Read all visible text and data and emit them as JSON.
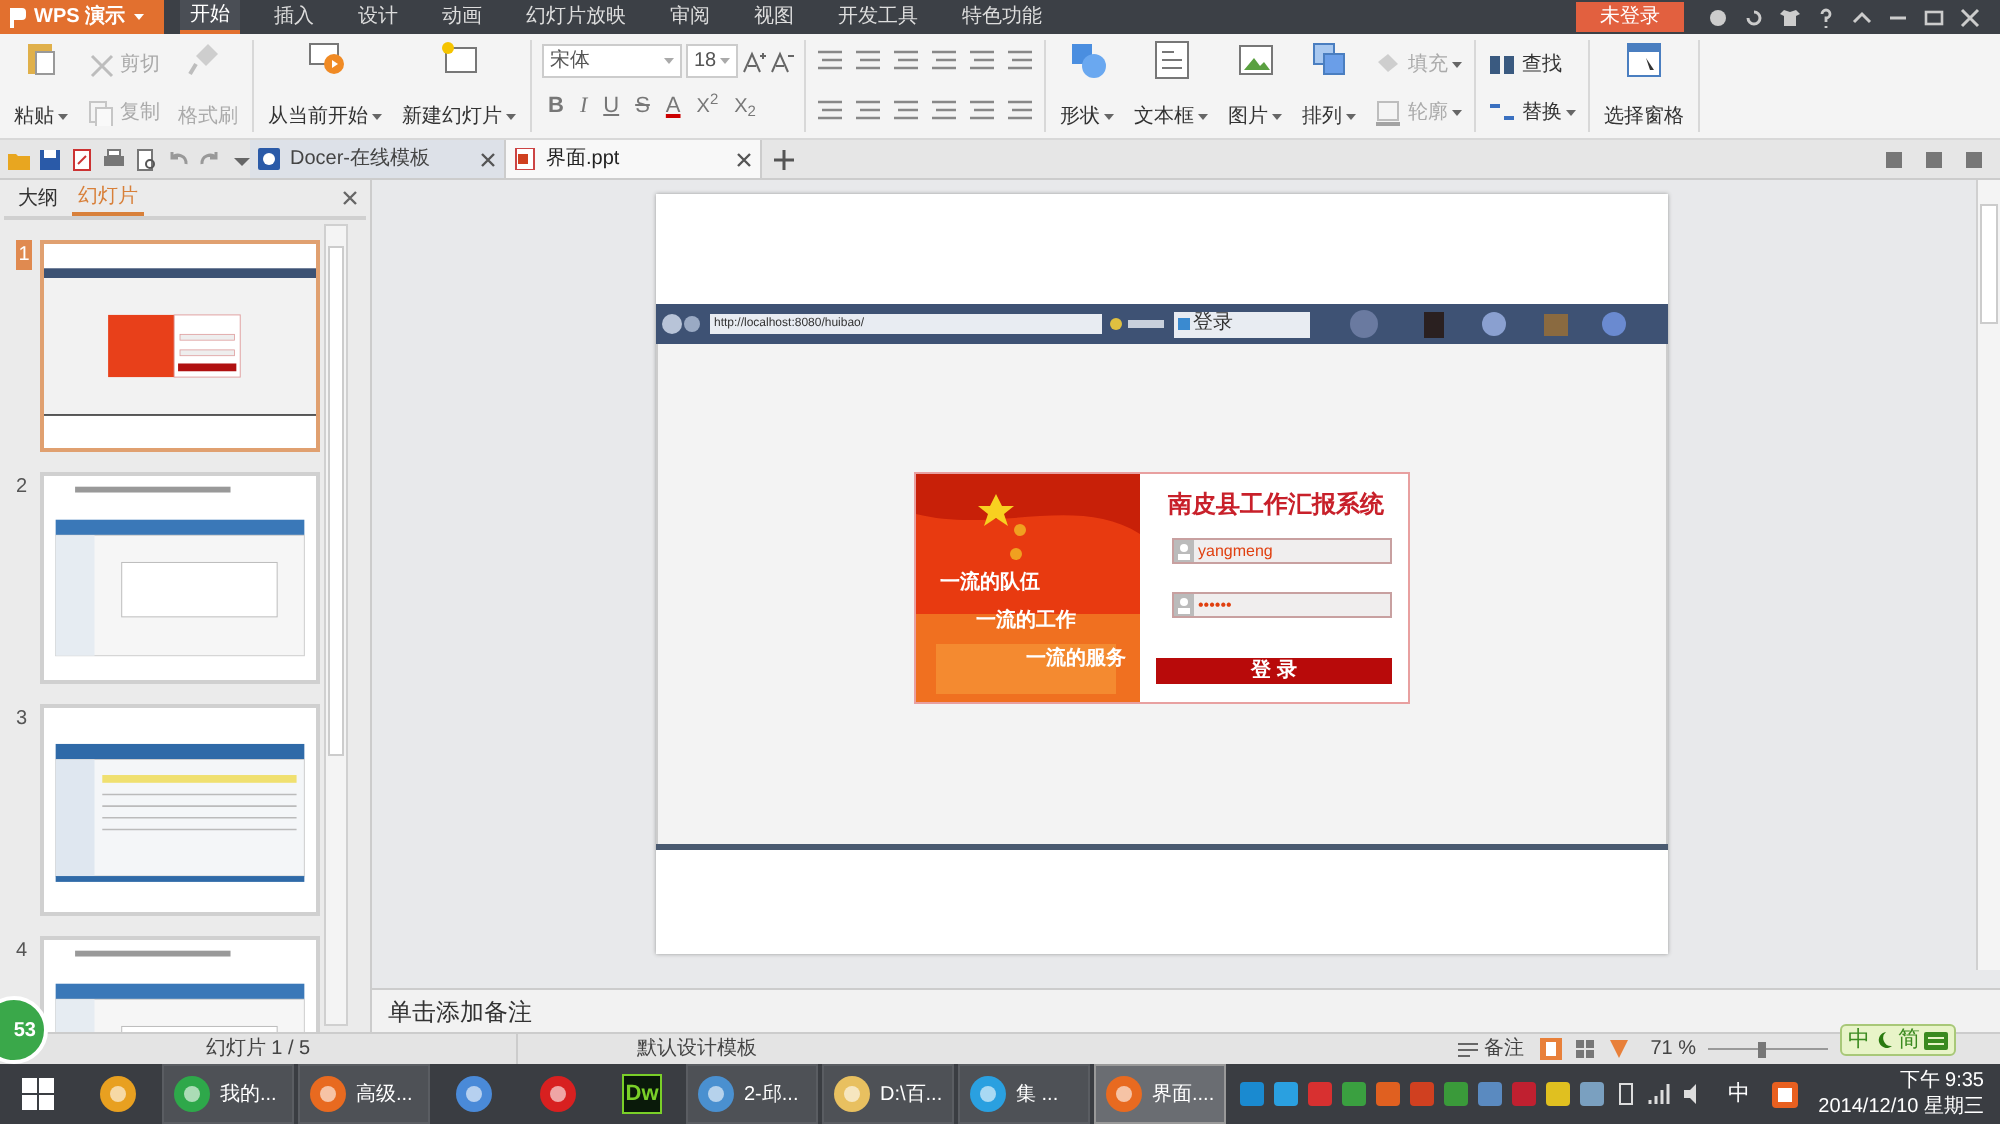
{
  "app_menu": {
    "label": "WPS 演示"
  },
  "ribbon_tabs": [
    {
      "label": "开始",
      "selected": true
    },
    {
      "label": "插入",
      "selected": false
    },
    {
      "label": "设计",
      "selected": false
    },
    {
      "label": "动画",
      "selected": false
    },
    {
      "label": "幻灯片放映",
      "selected": false
    },
    {
      "label": "审阅",
      "selected": false
    },
    {
      "label": "视图",
      "selected": false
    },
    {
      "label": "开发工具",
      "selected": false
    },
    {
      "label": "特色功能",
      "selected": false
    }
  ],
  "login_button": {
    "label": "未登录"
  },
  "ribbon": {
    "clipboard": [
      {
        "label": "粘贴",
        "kind": "big",
        "disabled": false,
        "dropdown": true
      },
      {
        "label": "剪切",
        "kind": "small",
        "disabled": true,
        "dropdown": false
      },
      {
        "label": "复制",
        "kind": "small",
        "disabled": true,
        "dropdown": false
      },
      {
        "label": "格式刷",
        "kind": "big",
        "disabled": true,
        "dropdown": false
      }
    ],
    "slides": [
      {
        "label": "从当前开始",
        "kind": "big",
        "disabled": false,
        "dropdown": true
      },
      {
        "label": "新建幻灯片",
        "kind": "big",
        "disabled": false,
        "dropdown": true
      }
    ],
    "font": {
      "family": "宋体",
      "size": "18",
      "format_buttons": [
        "B",
        "I",
        "U",
        "S",
        "A"
      ],
      "script_buttons": [
        "X$^{2}$",
        "X$_{2}$"
      ]
    },
    "drawing": [
      {
        "label": "形状",
        "kind": "big",
        "disabled": false,
        "dropdown": true
      },
      {
        "label": "文本框",
        "kind": "big",
        "disabled": false,
        "dropdown": true
      },
      {
        "label": "图片",
        "kind": "big",
        "disabled": false,
        "dropdown": true
      },
      {
        "label": "排列",
        "kind": "big",
        "disabled": false,
        "dropdown": true
      },
      {
        "label": "填充",
        "kind": "small",
        "disabled": true,
        "dropdown": true
      },
      {
        "label": "轮廓",
        "kind": "small",
        "disabled": true,
        "dropdown": true
      }
    ],
    "editing": [
      {
        "label": "查找",
        "kind": "small",
        "disabled": false,
        "dropdown": false
      },
      {
        "label": "替换",
        "kind": "small",
        "disabled": false,
        "dropdown": true
      }
    ],
    "pane": [
      {
        "label": "选择窗格",
        "kind": "big",
        "disabled": false,
        "dropdown": false
      }
    ]
  },
  "doc_tabs": [
    {
      "label": "Docer-在线模板",
      "selected": false
    },
    {
      "label": "界面.ppt",
      "selected": true
    }
  ],
  "sidebar": {
    "tabs": [
      {
        "label": "大纲",
        "selected": false
      },
      {
        "label": "幻灯片",
        "selected": true
      }
    ],
    "slides": [
      {
        "number": "1",
        "kind": "login",
        "selected": true
      },
      {
        "number": "2",
        "kind": "form",
        "selected": false
      },
      {
        "number": "3",
        "kind": "table",
        "selected": false
      },
      {
        "number": "4",
        "kind": "form",
        "selected": false
      }
    ]
  },
  "slide": {
    "browser": {
      "url": "http://localhost:8080/huibao/",
      "tab": "登录"
    },
    "login": {
      "title": "南皮县工作汇报系统",
      "username": "yangmeng",
      "password": "••••••",
      "button": "登 录",
      "slogans": [
        "一流的队伍",
        "一流的工作",
        "一流的服务"
      ]
    }
  },
  "notes": {
    "placeholder": "单击添加备注"
  },
  "status_bar": {
    "slide_counter": "幻灯片 1 / 5",
    "template": "默认设计模板",
    "notes_button": "备注",
    "zoom": "71 %",
    "zoom_slider": {
      "level": 0.45
    }
  },
  "floating_badge": "53",
  "ime_bar": {
    "mode": "中",
    "charset": "简"
  },
  "taskbar": {
    "items": [
      {
        "kind": "icon",
        "selected": false
      },
      {
        "kind": "app",
        "label": "我的...",
        "selected": false
      },
      {
        "kind": "app",
        "label": "高级...",
        "selected": false
      },
      {
        "kind": "icon",
        "selected": false
      },
      {
        "kind": "icon",
        "selected": false
      },
      {
        "kind": "logo",
        "label": "Dw",
        "selected": false
      },
      {
        "kind": "app",
        "label": "2-邱...",
        "selected": false
      },
      {
        "kind": "app",
        "label": "D:\\百...",
        "selected": false
      },
      {
        "kind": "app",
        "label": "集 ...",
        "selected": false
      },
      {
        "kind": "app",
        "label": "界面....",
        "selected": true
      }
    ],
    "ime": "中",
    "time": "下午 9:35",
    "date": "2014/12/10 星期三"
  }
}
